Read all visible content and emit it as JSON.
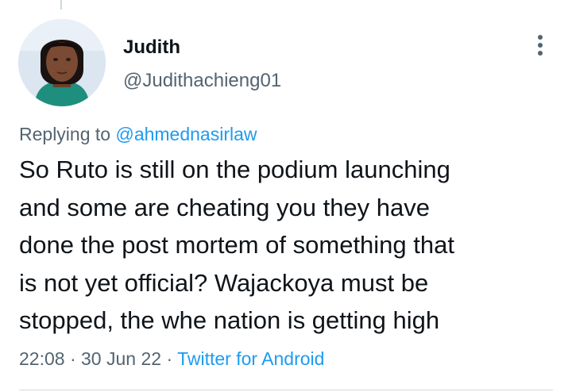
{
  "tweet": {
    "author": {
      "display_name": "Judith",
      "handle": "@Judithachieng01",
      "avatar_icon": "profile-photo"
    },
    "more_icon": "more-vertical-icon",
    "replying_prefix": "Replying to",
    "replying_to": "@ahmednasirlaw",
    "text": "So Ruto is still on the podium launching\nand some are cheating you they have\ndone the post mortem of something that\nis not yet official? Wajackoya must be\nstopped, the whe nation is getting high",
    "time": "22:08",
    "separator": "·",
    "date": "30 Jun 22",
    "source": "Twitter for Android"
  },
  "colors": {
    "text_primary": "#0f1419",
    "text_secondary": "#536471",
    "accent": "#1d9bf0",
    "divider": "#cfd9de"
  }
}
